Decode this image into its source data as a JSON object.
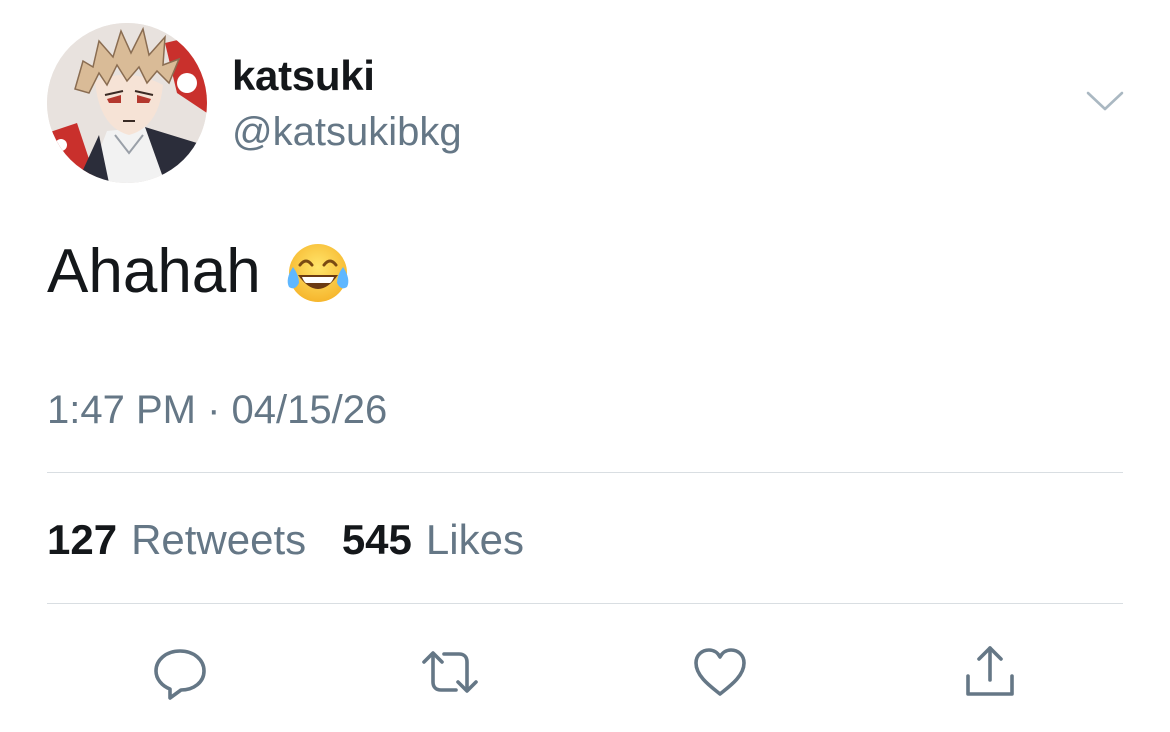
{
  "tweet": {
    "author": {
      "display_name": "katsuki",
      "handle": "@katsukibkg"
    },
    "text": "Ahahah",
    "emoji": "face-with-tears-of-joy",
    "timestamp": {
      "time": "1:47 PM",
      "separator": "·",
      "date": "04/15/26"
    },
    "stats": {
      "retweets_count": "127",
      "retweets_label": "Retweets",
      "likes_count": "545",
      "likes_label": "Likes"
    },
    "actions": {
      "reply_icon": "reply-icon",
      "retweet_icon": "retweet-icon",
      "like_icon": "heart-icon",
      "share_icon": "share-icon"
    }
  },
  "colors": {
    "primary_text": "#14171a",
    "secondary_text": "#657786",
    "divider": "#d9dee2",
    "background": "#ffffff"
  }
}
